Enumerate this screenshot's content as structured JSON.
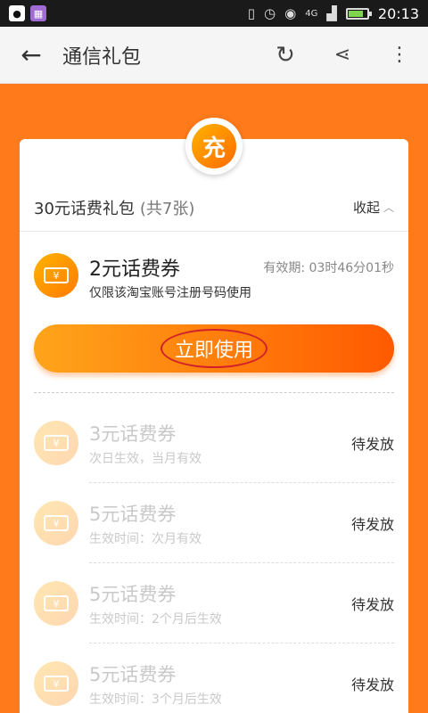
{
  "status_bar": {
    "left_icons": [
      "qq-icon",
      "gallery-app-icon"
    ],
    "signal_label": "4G",
    "battery_level": 0.8,
    "time": "20:13"
  },
  "header": {
    "back_icon": "arrow-left-icon",
    "title": "通信礼包",
    "actions": [
      "refresh-icon",
      "share-icon",
      "more-vertical-icon"
    ]
  },
  "badge": {
    "char": "充"
  },
  "pack": {
    "title": "30元话费礼包",
    "count": "(共7张)",
    "toggle_label": "收起"
  },
  "active_coupon": {
    "name": "2元话费券",
    "desc": "仅限该淘宝账号注册号码使用",
    "validity": "有效期: 03时46分01秒",
    "use_label": "立即使用"
  },
  "coupons": [
    {
      "name": "3元话费券",
      "desc": "次日生效，当月有效",
      "status": "待发放"
    },
    {
      "name": "5元话费券",
      "desc": "生效时间：次月有效",
      "status": "待发放"
    },
    {
      "name": "5元话费券",
      "desc": "生效时间：2个月后生效",
      "status": "待发放"
    },
    {
      "name": "5元话费券",
      "desc": "生效时间：3个月后生效",
      "status": "待发放"
    }
  ],
  "colors": {
    "brand_orange": "#ff7a1a",
    "button_start": "#ffa51a",
    "button_end": "#ff5a00"
  }
}
